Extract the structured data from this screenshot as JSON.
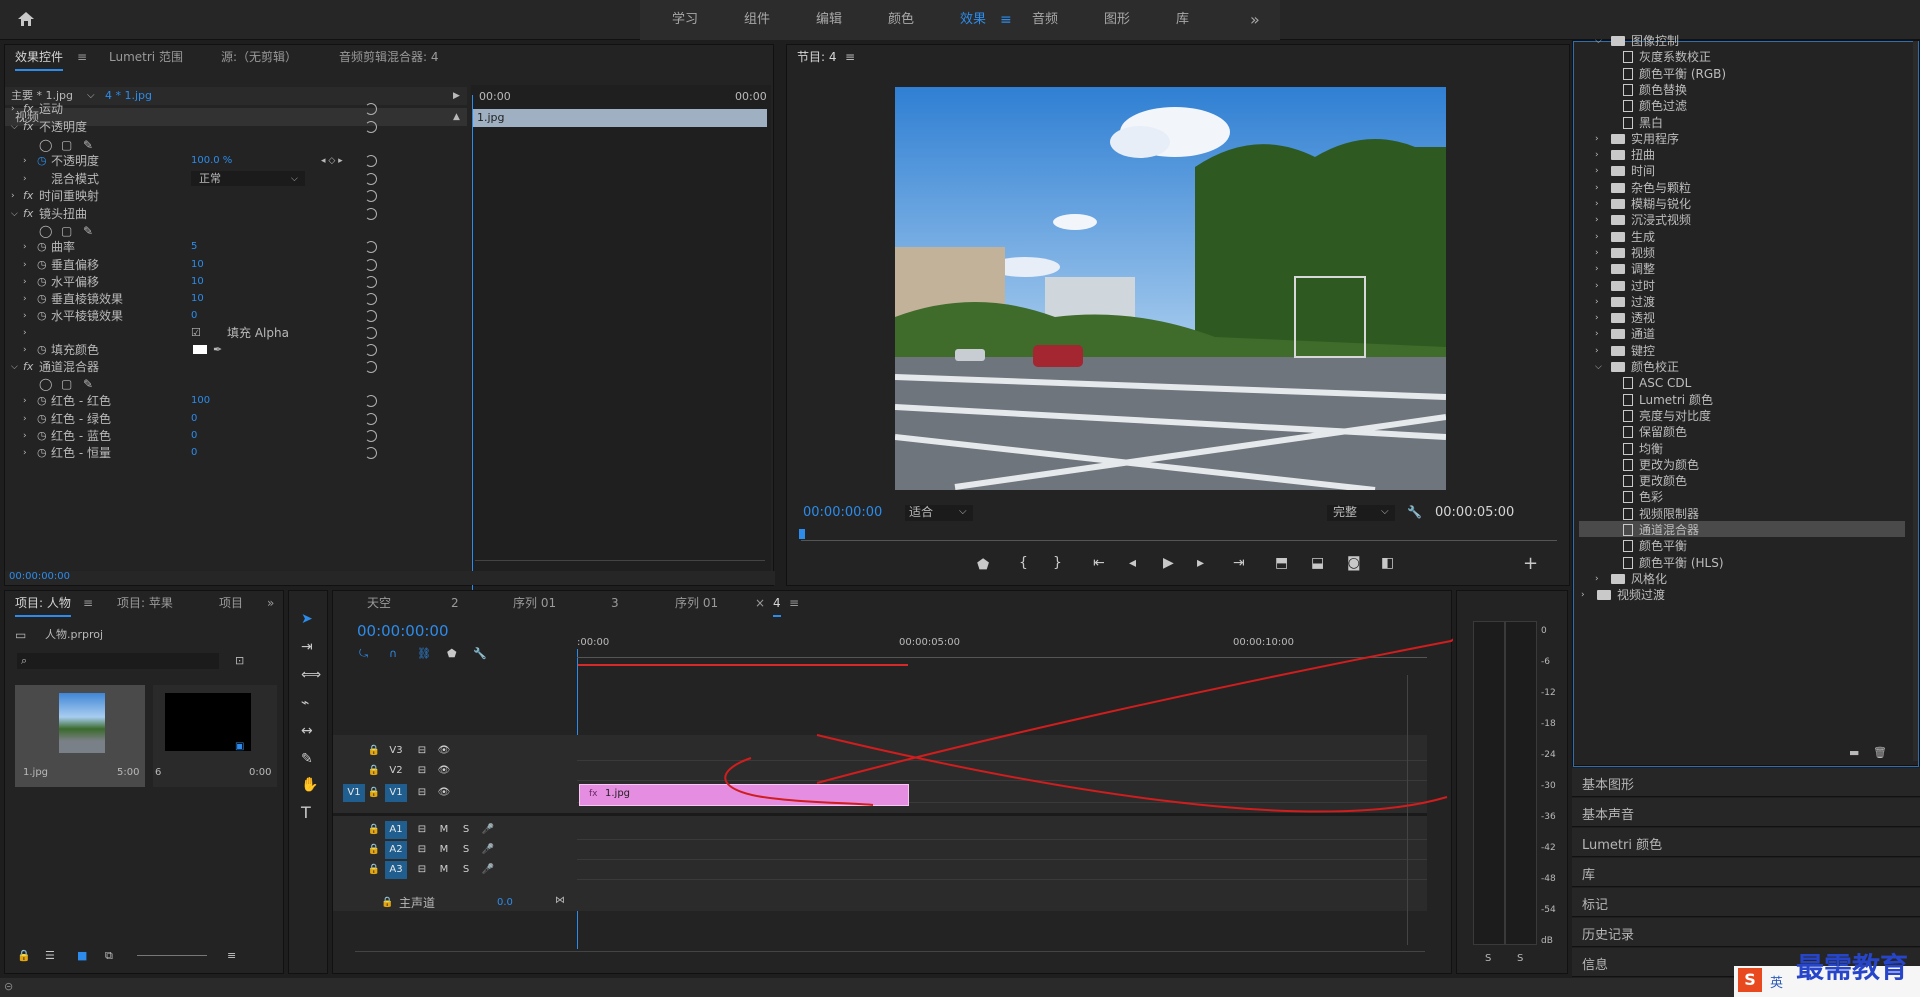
{
  "workspaces": [
    "学习",
    "组件",
    "编辑",
    "颜色",
    "效果",
    "音频",
    "图形",
    "库"
  ],
  "active_workspace": "效果",
  "effect_controls": {
    "tabs": [
      "效果控件",
      "Lumetri 范围",
      "源:（无剪辑）",
      "音频剪辑混合器: 4"
    ],
    "master_clip": "主要 * 1.jpg",
    "sequence_clip": "4 * 1.jpg",
    "time_start": "00:00",
    "time_end": "00:00",
    "clip_label": "1.jpg",
    "section": "视频",
    "rows": [
      {
        "indent": 0,
        "fx": true,
        "label": "运动",
        "value": ""
      },
      {
        "indent": 0,
        "fx": true,
        "label": "不透明度",
        "value": ""
      },
      {
        "indent": 1,
        "fx": false,
        "label": "不透明度",
        "value": "100.0 %"
      },
      {
        "indent": 1,
        "fx": false,
        "label": "混合模式",
        "value": "正常"
      },
      {
        "indent": 0,
        "fx": true,
        "label": "时间重映射",
        "value": ""
      },
      {
        "indent": 0,
        "fx": true,
        "label": "镜头扭曲",
        "value": ""
      },
      {
        "indent": 1,
        "fx": false,
        "label": "曲率",
        "value": "5"
      },
      {
        "indent": 1,
        "fx": false,
        "label": "垂直偏移",
        "value": "10"
      },
      {
        "indent": 1,
        "fx": false,
        "label": "水平偏移",
        "value": "10"
      },
      {
        "indent": 1,
        "fx": false,
        "label": "垂直棱镜效果",
        "value": "10"
      },
      {
        "indent": 1,
        "fx": false,
        "label": "水平棱镜效果",
        "value": "0"
      },
      {
        "indent": 1,
        "fx": false,
        "label": "填充 Alpha",
        "value": ""
      },
      {
        "indent": 1,
        "fx": false,
        "label": "填充颜色",
        "value": ""
      },
      {
        "indent": 0,
        "fx": true,
        "label": "通道混合器",
        "value": ""
      },
      {
        "indent": 1,
        "fx": false,
        "label": "红色 - 红色",
        "value": "100"
      },
      {
        "indent": 1,
        "fx": false,
        "label": "红色 - 绿色",
        "value": "0"
      },
      {
        "indent": 1,
        "fx": false,
        "label": "红色 - 蓝色",
        "value": "0"
      },
      {
        "indent": 1,
        "fx": false,
        "label": "红色 - 恒量",
        "value": "0"
      }
    ],
    "timecode": "00:00:00:00"
  },
  "program": {
    "title": "节目: 4",
    "timecode_left": "00:00:00:00",
    "fit": "适合",
    "quality": "完整",
    "timecode_right": "00:00:05:00"
  },
  "project": {
    "tabs": [
      "项目: 人物",
      "项目: 苹果",
      "项目"
    ],
    "file": "人物.prproj",
    "items": [
      {
        "name": "1.jpg",
        "duration": "5:00"
      },
      {
        "name": "6",
        "duration": "0:00"
      }
    ]
  },
  "timeline": {
    "tabs": [
      "天空",
      "2",
      "序列 01",
      "3",
      "序列 01",
      "4"
    ],
    "timecode": "00:00:00:00",
    "ruler": [
      ":00:00",
      "00:00:05:00",
      "00:00:10:00"
    ],
    "video_tracks": [
      "V3",
      "V2",
      "V1"
    ],
    "audio_tracks": [
      "A1",
      "A2",
      "A3"
    ],
    "source_patch": "V1",
    "master": "主声道",
    "master_value": "0.0",
    "clip": "1.jpg"
  },
  "meter": {
    "ticks": [
      "0",
      "-6",
      "-12",
      "-18",
      "-24",
      "-30",
      "-36",
      "-42",
      "-48",
      "-54",
      "dB"
    ],
    "solo": [
      "S",
      "S"
    ]
  },
  "effects_tree": [
    {
      "level": 1,
      "type": "folder",
      "label": "图像控制",
      "open": true
    },
    {
      "level": 2,
      "type": "item",
      "label": "灰度系数校正"
    },
    {
      "level": 2,
      "type": "item",
      "label": "颜色平衡 (RGB)"
    },
    {
      "level": 2,
      "type": "item",
      "label": "颜色替换"
    },
    {
      "level": 2,
      "type": "item",
      "label": "颜色过滤"
    },
    {
      "level": 2,
      "type": "item",
      "label": "黑白"
    },
    {
      "level": 1,
      "type": "folder",
      "label": "实用程序"
    },
    {
      "level": 1,
      "type": "folder",
      "label": "扭曲"
    },
    {
      "level": 1,
      "type": "folder",
      "label": "时间"
    },
    {
      "level": 1,
      "type": "folder",
      "label": "杂色与颗粒"
    },
    {
      "level": 1,
      "type": "folder",
      "label": "模糊与锐化"
    },
    {
      "level": 1,
      "type": "folder",
      "label": "沉浸式视频"
    },
    {
      "level": 1,
      "type": "folder",
      "label": "生成"
    },
    {
      "level": 1,
      "type": "folder",
      "label": "视频"
    },
    {
      "level": 1,
      "type": "folder",
      "label": "调整"
    },
    {
      "level": 1,
      "type": "folder",
      "label": "过时"
    },
    {
      "level": 1,
      "type": "folder",
      "label": "过渡"
    },
    {
      "level": 1,
      "type": "folder",
      "label": "透视"
    },
    {
      "level": 1,
      "type": "folder",
      "label": "通道"
    },
    {
      "level": 1,
      "type": "folder",
      "label": "键控"
    },
    {
      "level": 1,
      "type": "folder",
      "label": "颜色校正",
      "open": true
    },
    {
      "level": 2,
      "type": "item",
      "label": "ASC CDL"
    },
    {
      "level": 2,
      "type": "item",
      "label": "Lumetri 颜色"
    },
    {
      "level": 2,
      "type": "item",
      "label": "亮度与对比度"
    },
    {
      "level": 2,
      "type": "item",
      "label": "保留颜色"
    },
    {
      "level": 2,
      "type": "item",
      "label": "均衡"
    },
    {
      "level": 2,
      "type": "item",
      "label": "更改为颜色"
    },
    {
      "level": 2,
      "type": "item",
      "label": "更改颜色"
    },
    {
      "level": 2,
      "type": "item",
      "label": "色彩"
    },
    {
      "level": 2,
      "type": "item",
      "label": "视频限制器"
    },
    {
      "level": 2,
      "type": "item",
      "label": "通道混合器",
      "selected": true
    },
    {
      "level": 2,
      "type": "item",
      "label": "颜色平衡"
    },
    {
      "level": 2,
      "type": "item",
      "label": "颜色平衡 (HLS)"
    },
    {
      "level": 1,
      "type": "folder",
      "label": "风格化"
    },
    {
      "level": 0,
      "type": "folder",
      "label": "视频过渡"
    }
  ],
  "side_panels": [
    "基本图形",
    "基本声音",
    "Lumetri 颜色",
    "库",
    "标记",
    "历史记录",
    "信息"
  ],
  "watermark": "最需教育",
  "ime": "英"
}
